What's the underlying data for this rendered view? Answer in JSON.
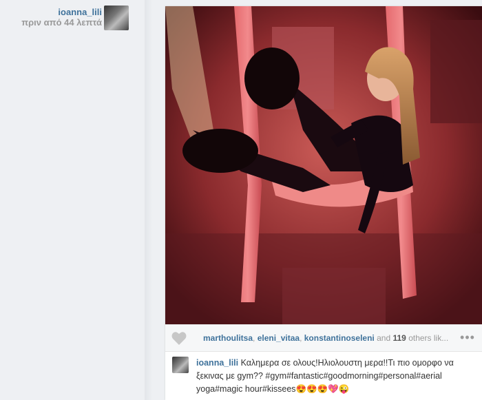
{
  "post": {
    "author": {
      "username": "ioanna_lili",
      "time_ago": "πριν από 44 λεπτά"
    },
    "likes": {
      "likers": [
        "marthoulitsa",
        "eleni_vitaa",
        "konstantinoseleni"
      ],
      "and_text": "and",
      "count": "119",
      "others_text": "others lik..."
    },
    "caption": {
      "username": "ioanna_lili",
      "text": "Καλημερα σε ολους!Ηλιολουστη μερα!!Τι πιο ομορφο να ξεκινας με gym?? #gym#fantastic#goodmorning#personal#aerial yoga#magic hour#kissees😍😍😍💖😜"
    },
    "icons": {
      "like": "heart-icon",
      "more": "more-options-icon",
      "avatar": "user-avatar"
    },
    "colors": {
      "link": "#3f729b",
      "muted": "#999999",
      "photo_tint": "#c4343f"
    }
  }
}
